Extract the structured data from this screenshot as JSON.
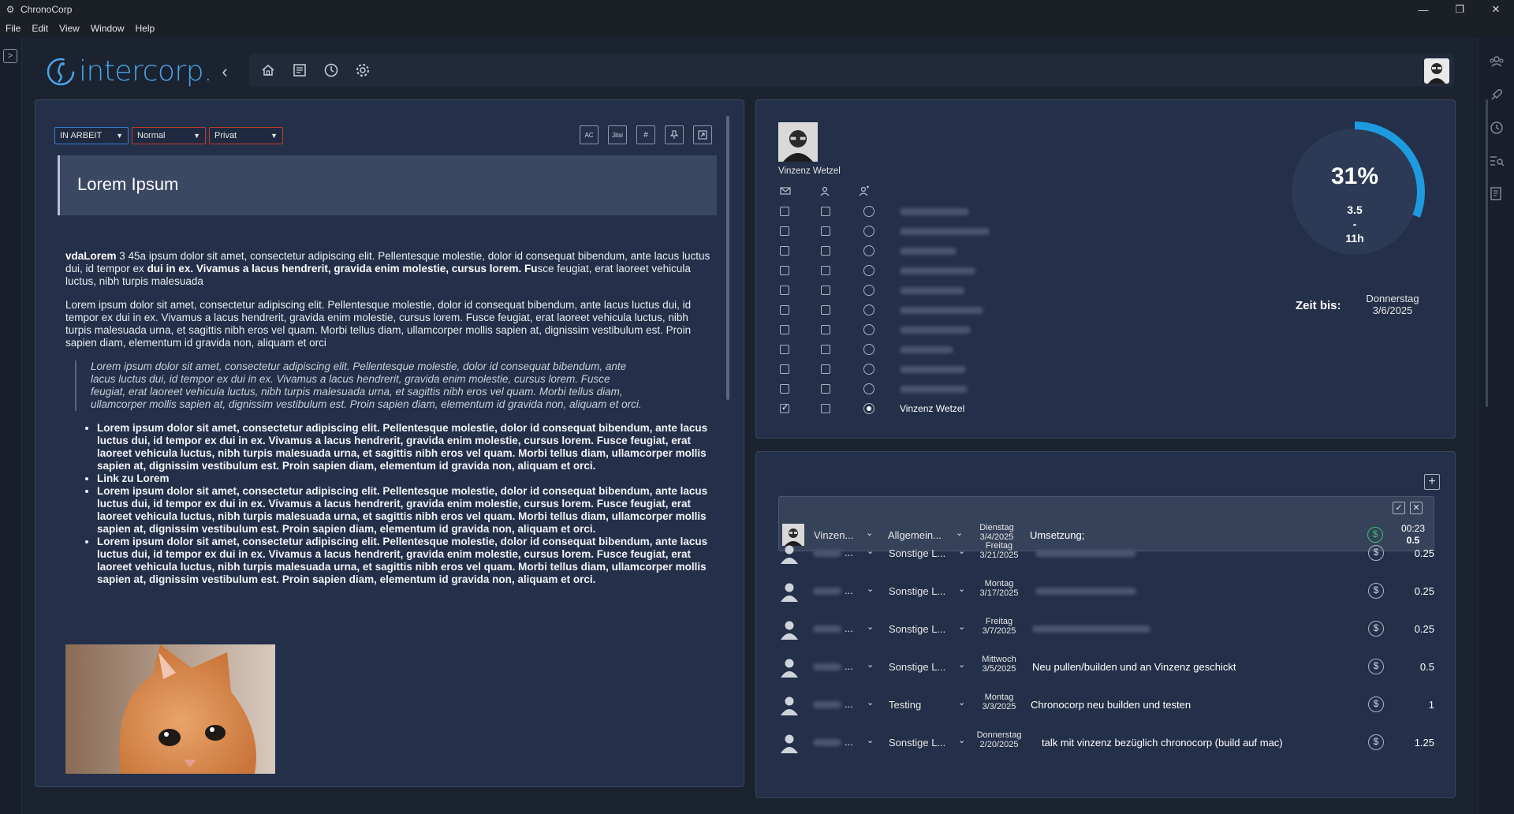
{
  "window": {
    "title": "ChronoCorp",
    "minimize": "—",
    "restore": "❐",
    "close": "✕"
  },
  "menu": [
    "File",
    "Edit",
    "View",
    "Window",
    "Help"
  ],
  "brand": {
    "name": "intercorp.",
    "accent": "#4aa3e8"
  },
  "nav": {
    "back": "‹",
    "forward": "›"
  },
  "toolbar_icons": [
    "home-icon",
    "list-icon",
    "clock-icon",
    "gear-icon"
  ],
  "right_sidebar_icons": [
    "team-icon",
    "rocket-icon",
    "history-icon",
    "search-list-icon",
    "notes-icon"
  ],
  "ticket": {
    "status": "IN ARBEIT",
    "priority": "Normal",
    "scope": "Privat",
    "editor_buttons": [
      "AC",
      "Jitsi",
      "#",
      "pin",
      "export"
    ],
    "title": "Lorem Ipsum",
    "p1_a": "vdaLorem",
    "p1_b": " 3 45a ipsum dolor sit amet, consectetur adipiscing elit. Pellentesque molestie, dolor id consequat bibendum, ante lacus luctus dui, id tempor ex ",
    "p1_c": "dui in ex. Vivamus a lacus hendrerit, gravida enim molestie, cursus lorem. Fu",
    "p1_d": "sce feugiat, erat laoreet vehicula luctus, nibh turpis malesuada",
    "p2": "Lorem ipsum dolor sit amet, consectetur adipiscing elit. Pellentesque molestie, dolor id consequat bibendum, ante lacus luctus dui, id tempor ex dui in ex. Vivamus a lacus hendrerit, gravida enim molestie, cursus lorem. Fusce feugiat, erat laoreet vehicula luctus, nibh turpis malesuada urna, et sagittis nibh eros vel quam. Morbi tellus diam, ullamcorper mollis sapien at, dignissim vestibulum est. Proin sapien diam, elementum id gravida non, aliquam et orci",
    "quote": "Lorem ipsum dolor sit amet, consectetur adipiscing elit. Pellentesque molestie, dolor id consequat bibendum, ante lacus luctus dui, id tempor ex dui in ex. Vivamus a lacus hendrerit, gravida enim molestie, cursus lorem. Fusce feugiat, erat laoreet vehicula luctus, nibh turpis malesuada urna, et sagittis nibh eros vel quam. Morbi tellus diam, ullamcorper mollis sapien at, dignissim vestibulum est. Proin sapien diam, elementum id gravida non, aliquam et orci.",
    "bullets": [
      "Lorem ipsum dolor sit amet, consectetur adipiscing elit. Pellentesque molestie, dolor id consequat bibendum, ante lacus luctus dui, id tempor ex dui in ex. Vivamus a lacus hendrerit, gravida enim molestie, cursus lorem. Fusce feugiat, erat laoreet vehicula luctus, nibh turpis malesuada urna, et sagittis nibh eros vel quam. Morbi tellus diam, ullamcorper mollis sapien at, dignissim vestibulum est. Proin sapien diam, elementum id gravida non, aliquam et orci.",
      "Link zu Lorem",
      "Lorem ipsum dolor sit amet, consectetur adipiscing elit. Pellentesque molestie, dolor id consequat bibendum, ante lacus luctus dui, id tempor ex dui in ex. Vivamus a lacus hendrerit, gravida enim molestie, cursus lorem. Fusce feugiat, erat laoreet vehicula luctus, nibh turpis malesuada urna, et sagittis nibh eros vel quam. Morbi tellus diam, ullamcorper mollis sapien at, dignissim vestibulum est. Proin sapien diam, elementum id gravida non, aliquam et orci.",
      "Lorem ipsum dolor sit amet, consectetur adipiscing elit. Pellentesque molestie, dolor id consequat bibendum, ante lacus luctus dui, id tempor ex dui in ex. Vivamus a lacus hendrerit, gravida enim molestie, cursus lorem. Fusce feugiat, erat laoreet vehicula luctus, nibh turpis malesuada urna, et sagittis nibh eros vel quam. Morbi tellus diam, ullamcorper mollis sapien at, dignissim vestibulum est. Proin sapien diam, elementum id gravida non, aliquam et orci."
    ]
  },
  "assignees": {
    "owner_name": "Vinzenz Wetzel",
    "column_icons": [
      "mail-icon",
      "person-icon",
      "assign-icon"
    ],
    "rows": [
      {
        "name": "",
        "mail": false,
        "person": false,
        "selected": false
      },
      {
        "name": "",
        "mail": false,
        "person": false,
        "selected": false
      },
      {
        "name": "",
        "mail": false,
        "person": false,
        "selected": false
      },
      {
        "name": "",
        "mail": false,
        "person": false,
        "selected": false
      },
      {
        "name": "",
        "mail": false,
        "person": false,
        "selected": false
      },
      {
        "name": "",
        "mail": false,
        "person": false,
        "selected": false
      },
      {
        "name": "",
        "mail": false,
        "person": false,
        "selected": false
      },
      {
        "name": "",
        "mail": false,
        "person": false,
        "selected": false
      },
      {
        "name": "",
        "mail": false,
        "person": false,
        "selected": false
      },
      {
        "name": "",
        "mail": false,
        "person": false,
        "selected": false
      },
      {
        "name": "Vinzenz Wetzel",
        "mail": true,
        "person": false,
        "selected": true
      }
    ]
  },
  "progress": {
    "percent_label": "31%",
    "percent_value": 0.31,
    "spent": "3.5",
    "sep": "-",
    "total": "11h",
    "ring_color": "#1e9be0",
    "deadline_label": "Zeit bis:",
    "deadline_day": "Donnerstag",
    "deadline_date": "3/6/2025"
  },
  "time_entries": {
    "add_label": "+",
    "active": {
      "user": "Vinzen...",
      "category": "Allgemein...",
      "day": "Dienstag",
      "date": "3/4/2025",
      "description": "Umsetzung;",
      "timer": "00:23",
      "hours": "0.5",
      "billable_color": "#3bbf6a",
      "confirm": "✓",
      "discard": "✕"
    },
    "rows": [
      {
        "user": "",
        "category": "Sonstige L...",
        "day": "Freitag",
        "date": "3/21/2025",
        "description": "",
        "hours": "0.25"
      },
      {
        "user": "",
        "category": "Sonstige L...",
        "day": "Montag",
        "date": "3/17/2025",
        "description": "",
        "hours": "0.25"
      },
      {
        "user": "",
        "category": "Sonstige L...",
        "day": "Freitag",
        "date": "3/7/2025",
        "description": "",
        "hours": "0.25"
      },
      {
        "user": "",
        "category": "Sonstige L...",
        "day": "Mittwoch",
        "date": "3/5/2025",
        "description": "Neu pullen/builden und an Vinzenz geschickt",
        "hours": "0.5"
      },
      {
        "user": "",
        "category": "Testing",
        "day": "Montag",
        "date": "3/3/2025",
        "description": "Chronocorp neu builden und testen",
        "hours": "1"
      },
      {
        "user": "",
        "category": "Sonstige L...",
        "day": "Donnerstag",
        "date": "2/20/2025",
        "description": "talk mit vinzenz bezüglich chronocorp (build auf mac)",
        "hours": "1.25"
      }
    ]
  }
}
